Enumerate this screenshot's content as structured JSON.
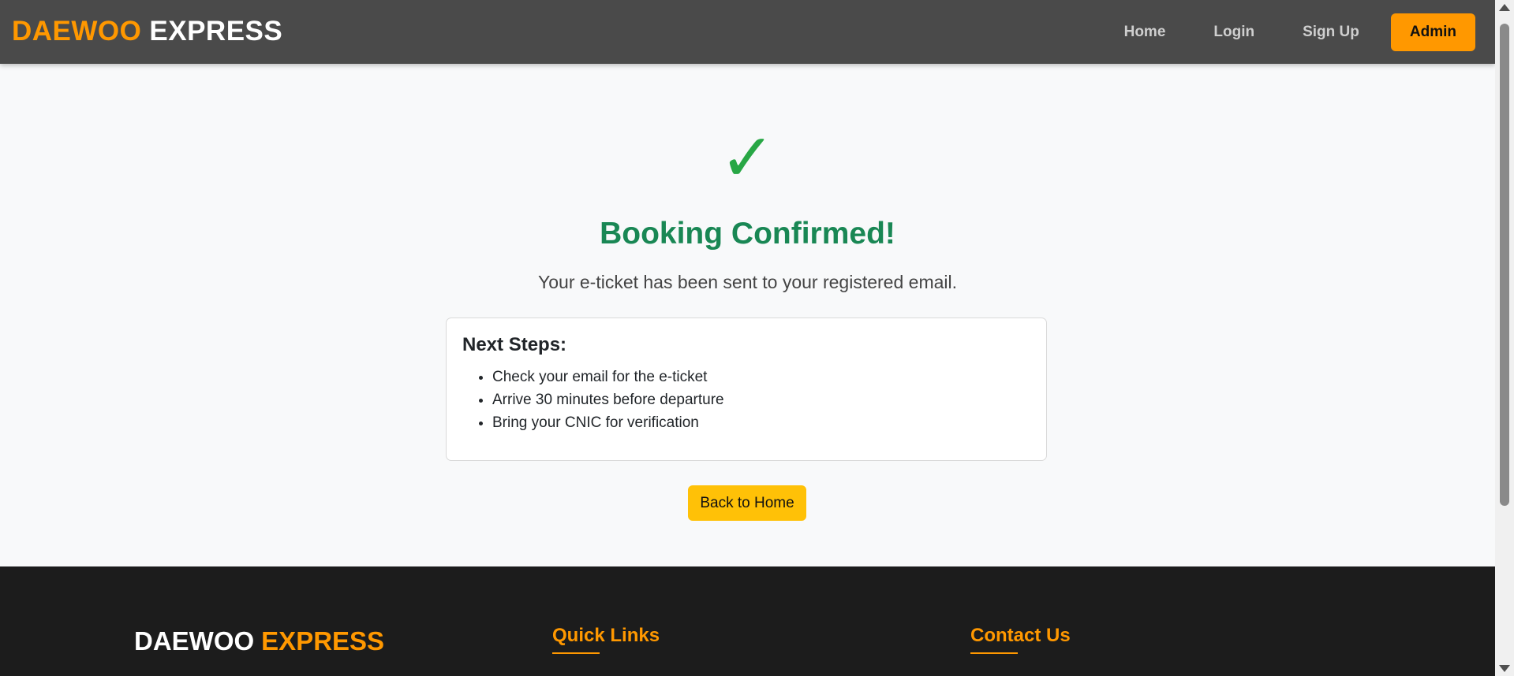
{
  "header": {
    "brand_part1": "DAEWOO",
    "brand_part2": "EXPRESS",
    "nav": {
      "home": "Home",
      "login": "Login",
      "signup": "Sign Up",
      "admin": "Admin"
    }
  },
  "main": {
    "check_icon": "✓",
    "title": "Booking Confirmed!",
    "subtitle": "Your e-ticket has been sent to your registered email.",
    "next_steps": {
      "heading": "Next Steps:",
      "items": [
        "Check your email for the e-ticket",
        "Arrive 30 minutes before departure",
        "Bring your CNIC for verification"
      ]
    },
    "back_button": "Back to Home"
  },
  "footer": {
    "brand_part1": "DAEWOO",
    "brand_part2": "EXPRESS",
    "quick_links_heading": "Quick Links",
    "contact_heading": "Contact Us"
  },
  "colors": {
    "accent": "#ff9800",
    "success": "#198754",
    "button": "#ffc107",
    "header_bg": "#4a4a4a",
    "footer_bg": "#1c1c1c"
  }
}
